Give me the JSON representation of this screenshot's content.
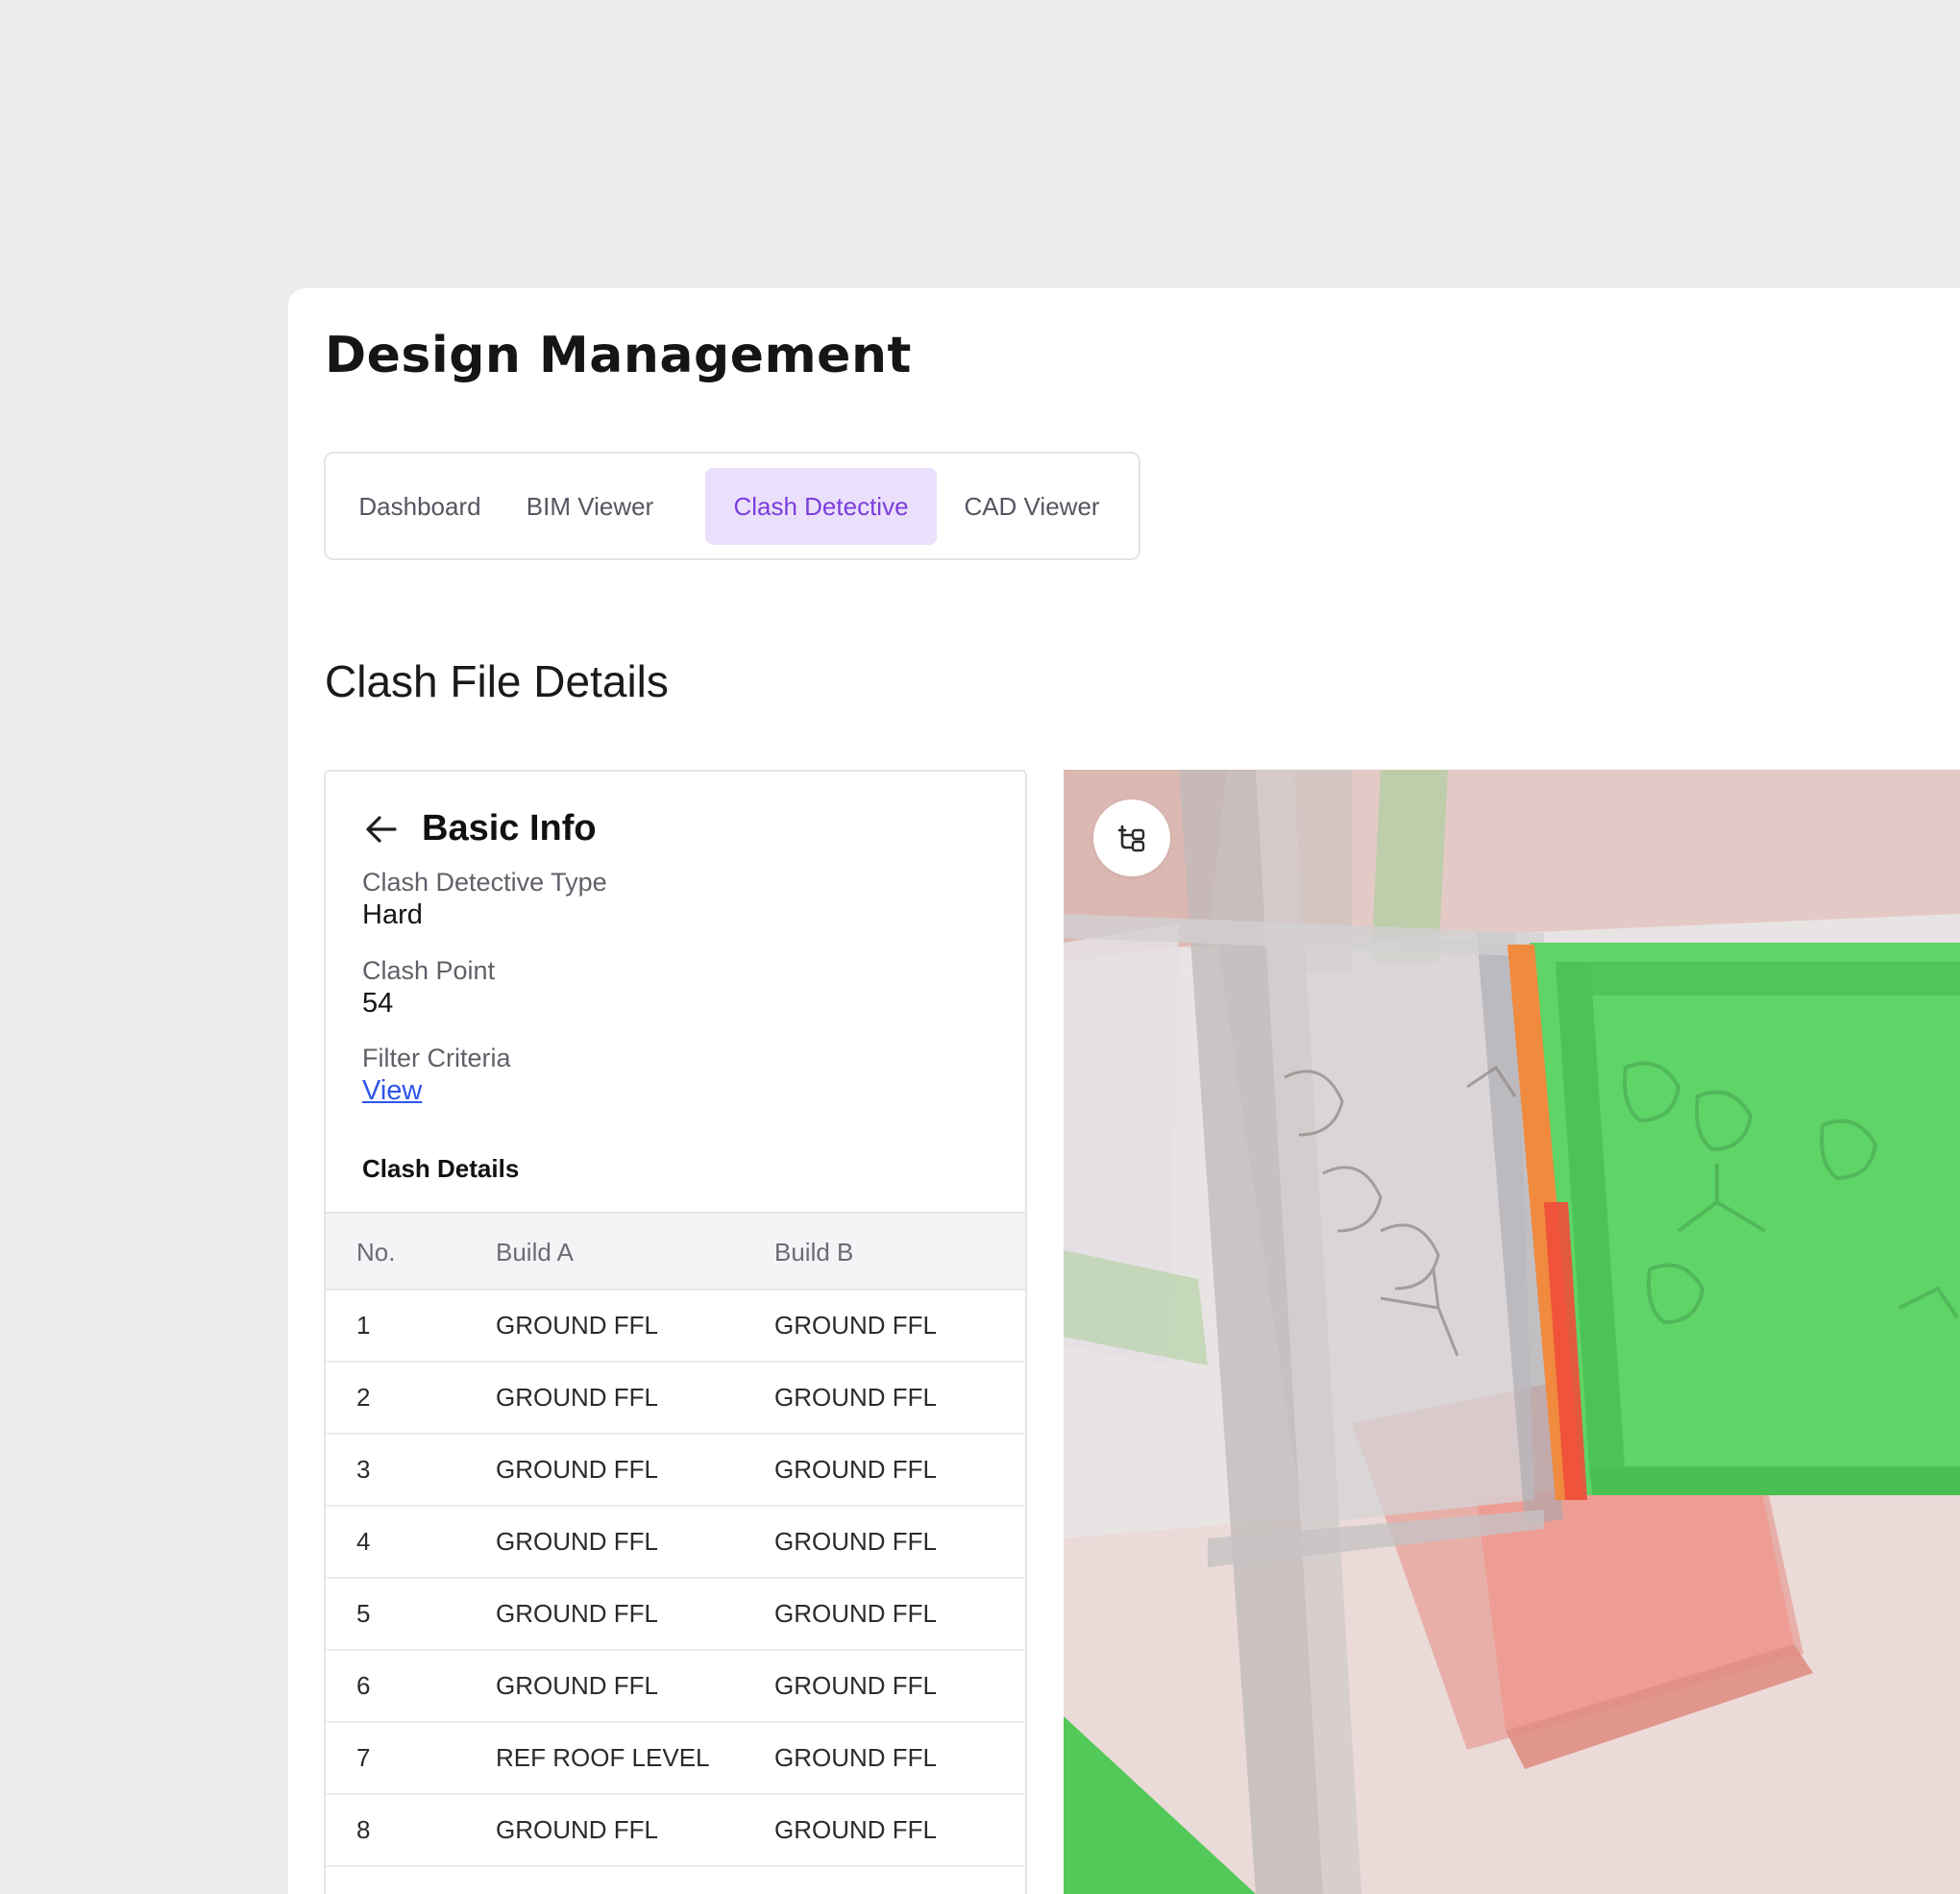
{
  "page": {
    "title": "Design Management"
  },
  "tabs": [
    {
      "label": "Dashboard",
      "active": false
    },
    {
      "label": "BIM Viewer",
      "active": false
    },
    {
      "label": "Clash Detective",
      "active": true
    },
    {
      "label": "CAD Viewer",
      "active": false
    }
  ],
  "section": {
    "title": "Clash File Details"
  },
  "basic_info": {
    "heading": "Basic Info",
    "back_icon": "arrow-left-icon",
    "fields": {
      "type_label": "Clash Detective Type",
      "type_value": "Hard",
      "point_label": "Clash Point",
      "point_value": "54",
      "filter_label": "Filter Criteria",
      "filter_link": "View"
    }
  },
  "clash_details": {
    "heading": "Clash Details",
    "columns": [
      "No.",
      "Build A",
      "Build B"
    ],
    "rows": [
      {
        "no": "1",
        "build_a": "GROUND FFL",
        "build_b": "GROUND FFL"
      },
      {
        "no": "2",
        "build_a": "GROUND FFL",
        "build_b": "GROUND FFL"
      },
      {
        "no": "3",
        "build_a": "GROUND FFL",
        "build_b": "GROUND FFL"
      },
      {
        "no": "4",
        "build_a": "GROUND FFL",
        "build_b": "GROUND FFL"
      },
      {
        "no": "5",
        "build_a": "GROUND FFL",
        "build_b": "GROUND FFL"
      },
      {
        "no": "6",
        "build_a": "GROUND FFL",
        "build_b": "GROUND FFL"
      },
      {
        "no": "7",
        "build_a": "REF ROOF LEVEL",
        "build_b": "GROUND FFL"
      },
      {
        "no": "8",
        "build_a": "GROUND FFL",
        "build_b": "GROUND FFL"
      }
    ]
  },
  "viewer": {
    "tree_icon": "model-tree-icon"
  },
  "colors": {
    "accent": "#7b3ddb",
    "accent_bg": "#ebe0fc",
    "link": "#2e55e8",
    "clash_green": "#5fd467",
    "clash_red": "#f0604c"
  }
}
